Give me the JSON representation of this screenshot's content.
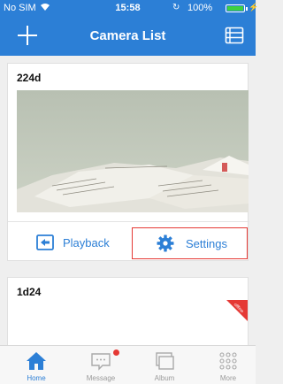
{
  "status_bar": {
    "carrier": "No SIM",
    "time": "15:58",
    "battery": "100%"
  },
  "nav": {
    "title": "Camera List",
    "add_icon": "plus-icon",
    "list_icon": "list-icon"
  },
  "cameras": [
    {
      "name": "224d",
      "actions": {
        "playback_label": "Playback",
        "settings_label": "Settings"
      }
    },
    {
      "name": "1d24",
      "status_badge": "offline"
    }
  ],
  "tabs": [
    {
      "label": "Home",
      "icon": "home-icon",
      "active": true
    },
    {
      "label": "Message",
      "icon": "message-icon",
      "active": false,
      "has_notification": true
    },
    {
      "label": "Album",
      "icon": "album-icon",
      "active": false
    },
    {
      "label": "More",
      "icon": "more-grid-icon",
      "active": false
    }
  ],
  "colors": {
    "primary": "#2c7fd6",
    "highlight": "#e53935",
    "offline": "#e53935"
  }
}
